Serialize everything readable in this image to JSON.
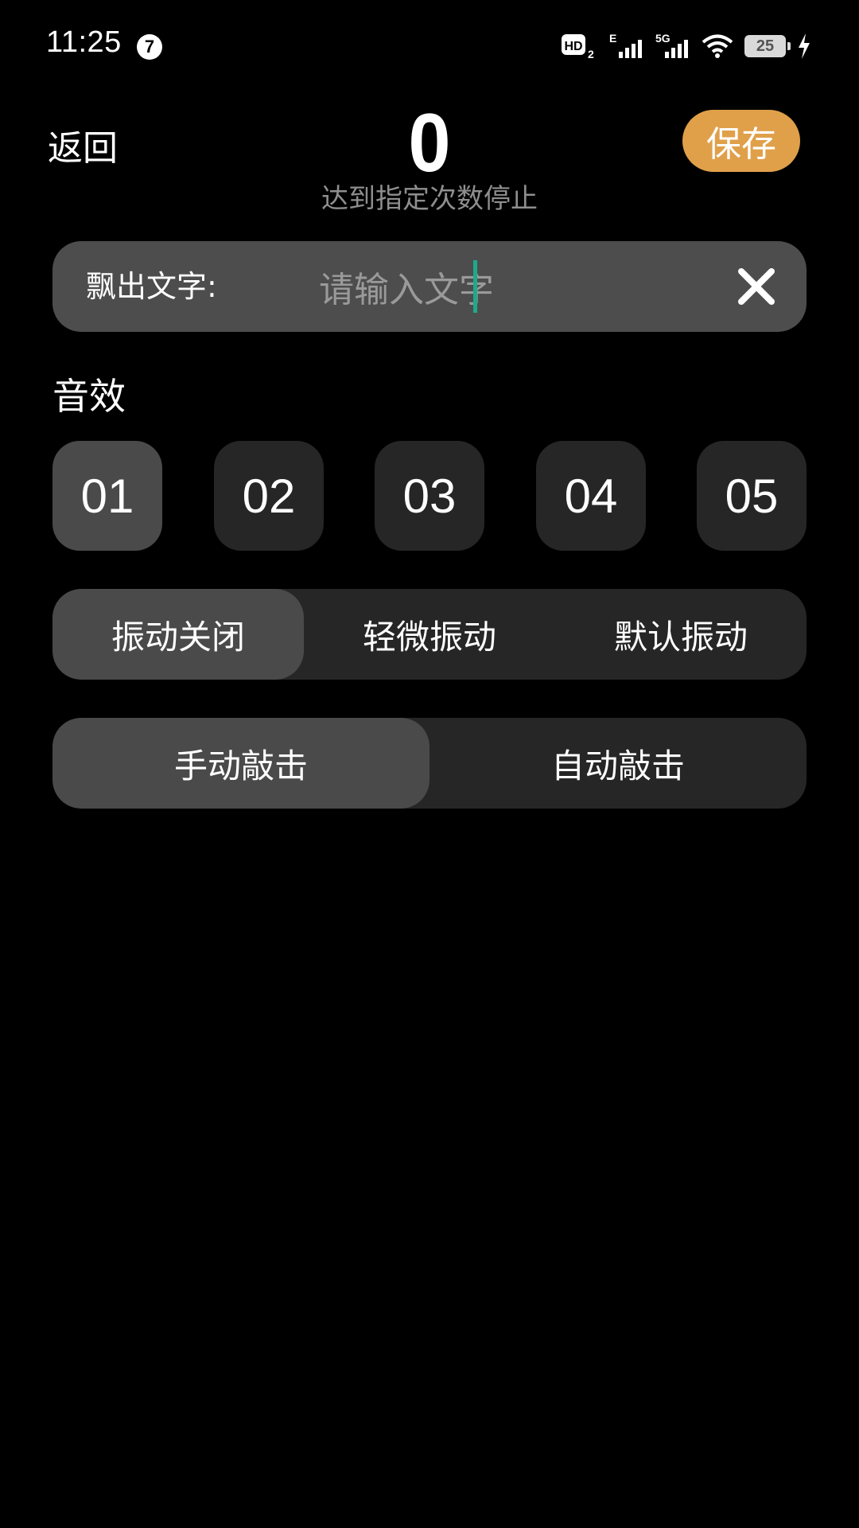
{
  "status_bar": {
    "time": "11:25",
    "notification_count": "7",
    "network_hd": "HD",
    "network_hd_sub": "2",
    "network_e": "E",
    "network_5g": "5G",
    "battery_level": "25"
  },
  "header": {
    "back_label": "返回",
    "counter_value": "0",
    "counter_subtitle": "达到指定次数停止",
    "save_label": "保存",
    "save_color": "#e0a04a"
  },
  "float_text": {
    "label": "飘出文字:",
    "placeholder": "请输入文字",
    "value": "",
    "caret_color": "#1fa98c",
    "clear_icon": "close-icon"
  },
  "sound": {
    "title": "音效",
    "options": [
      "01",
      "02",
      "03",
      "04",
      "05"
    ],
    "selected": "01"
  },
  "vibration": {
    "options": [
      "振动关闭",
      "轻微振动",
      "默认振动"
    ],
    "selected": "振动关闭"
  },
  "tap_mode": {
    "options": [
      "手动敲击",
      "自动敲击"
    ],
    "selected": "手动敲击"
  }
}
